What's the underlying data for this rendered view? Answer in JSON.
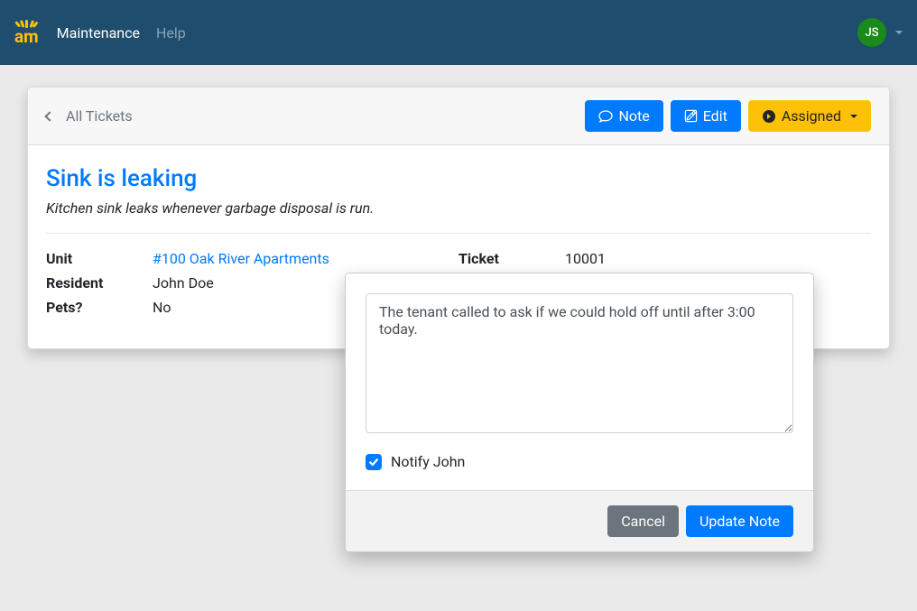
{
  "navbar": {
    "logo_text": "am",
    "links": {
      "maintenance": "Maintenance",
      "help": "Help"
    },
    "user_initials": "JS"
  },
  "header": {
    "back_label": "All Tickets",
    "note_label": "Note",
    "edit_label": "Edit",
    "status_label": "Assigned"
  },
  "ticket": {
    "title": "Sink is leaking",
    "description": "Kitchen sink leaks whenever garbage disposal is run.",
    "labels": {
      "unit": "Unit",
      "resident": "Resident",
      "pets": "Pets?",
      "ticket": "Ticket"
    },
    "unit_link": "#100 Oak River Apartments",
    "resident": "John Doe",
    "pets": "No",
    "ticket_number": "10001"
  },
  "modal": {
    "note_text": "The tenant called to ask if we could hold off until after 3:00 today.",
    "notify_label": "Notify John",
    "notify_checked": true,
    "cancel_label": "Cancel",
    "update_label": "Update Note"
  }
}
